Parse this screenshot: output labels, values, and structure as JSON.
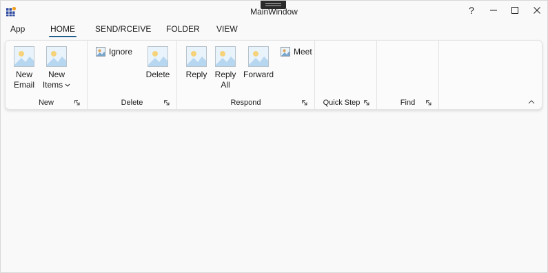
{
  "window": {
    "title": "MainWindow",
    "controls": {
      "help": "?",
      "minimize_icon": "minimize-icon",
      "maximize_icon": "maximize-icon",
      "close_icon": "close-icon"
    }
  },
  "tabs": [
    {
      "label": "App"
    },
    {
      "label": "HOME",
      "active": true
    },
    {
      "label": "SEND/RCEIVE"
    },
    {
      "label": "FOLDER"
    },
    {
      "label": "VIEW"
    }
  ],
  "ribbon": {
    "groups": {
      "new": {
        "label": "New",
        "new_email": [
          "New",
          "Email"
        ],
        "new_items": [
          "New",
          "Items"
        ]
      },
      "delete": {
        "label": "Delete",
        "ignore": "Ignore",
        "delete": "Delete"
      },
      "respond": {
        "label": "Respond",
        "reply": "Reply",
        "reply_all": [
          "Reply",
          "All"
        ],
        "forward": "Forward",
        "meeting": "Meet"
      },
      "quick_steps": {
        "label": "Quick Step"
      },
      "find": {
        "label": "Find"
      }
    }
  },
  "colors": {
    "accent": "#1f5f8b",
    "background": "#f9f9f9"
  }
}
